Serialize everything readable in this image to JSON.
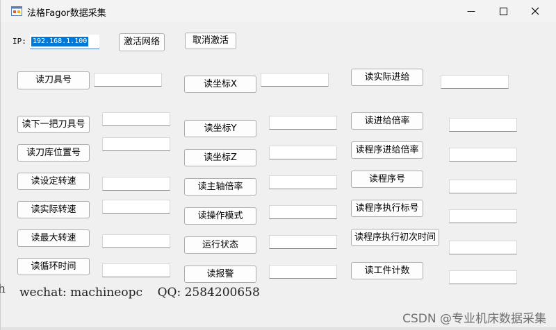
{
  "window": {
    "title": "法格Fagor数据采集",
    "minimize_glyph": "—",
    "maximize_glyph": "☐",
    "close_glyph": "✕"
  },
  "connection": {
    "ip_label": "IP:",
    "ip_value": "192.168.1.100",
    "activate_label": "激活网络",
    "deactivate_label": "取消激活"
  },
  "column1": [
    {
      "label": "读刀具号"
    },
    {
      "label": "读下一把刀具号"
    },
    {
      "label": "读刀库位置号"
    },
    {
      "label": "读设定转速"
    },
    {
      "label": "读实际转速"
    },
    {
      "label": "读最大转速"
    },
    {
      "label": "读循环时间"
    }
  ],
  "column2": [
    {
      "label": "读坐标X"
    },
    {
      "label": "读坐标Y"
    },
    {
      "label": "读坐标Z"
    },
    {
      "label": "读主轴倍率"
    },
    {
      "label": "读操作模式"
    },
    {
      "label": "运行状态"
    },
    {
      "label": "读报警"
    }
  ],
  "column3": [
    {
      "label": "读实际进给"
    },
    {
      "label": "读进给倍率"
    },
    {
      "label": "读程序进给倍率"
    },
    {
      "label": "读程序号"
    },
    {
      "label": "读程序执行标号"
    },
    {
      "label": "读程序执行初次时间"
    },
    {
      "label": "读工件计数"
    }
  ],
  "footer": {
    "contact": "wechat: machineopc    QQ: 2584200658",
    "edge_fragment": "h"
  },
  "watermark": "CSDN @专业机床数据采集"
}
